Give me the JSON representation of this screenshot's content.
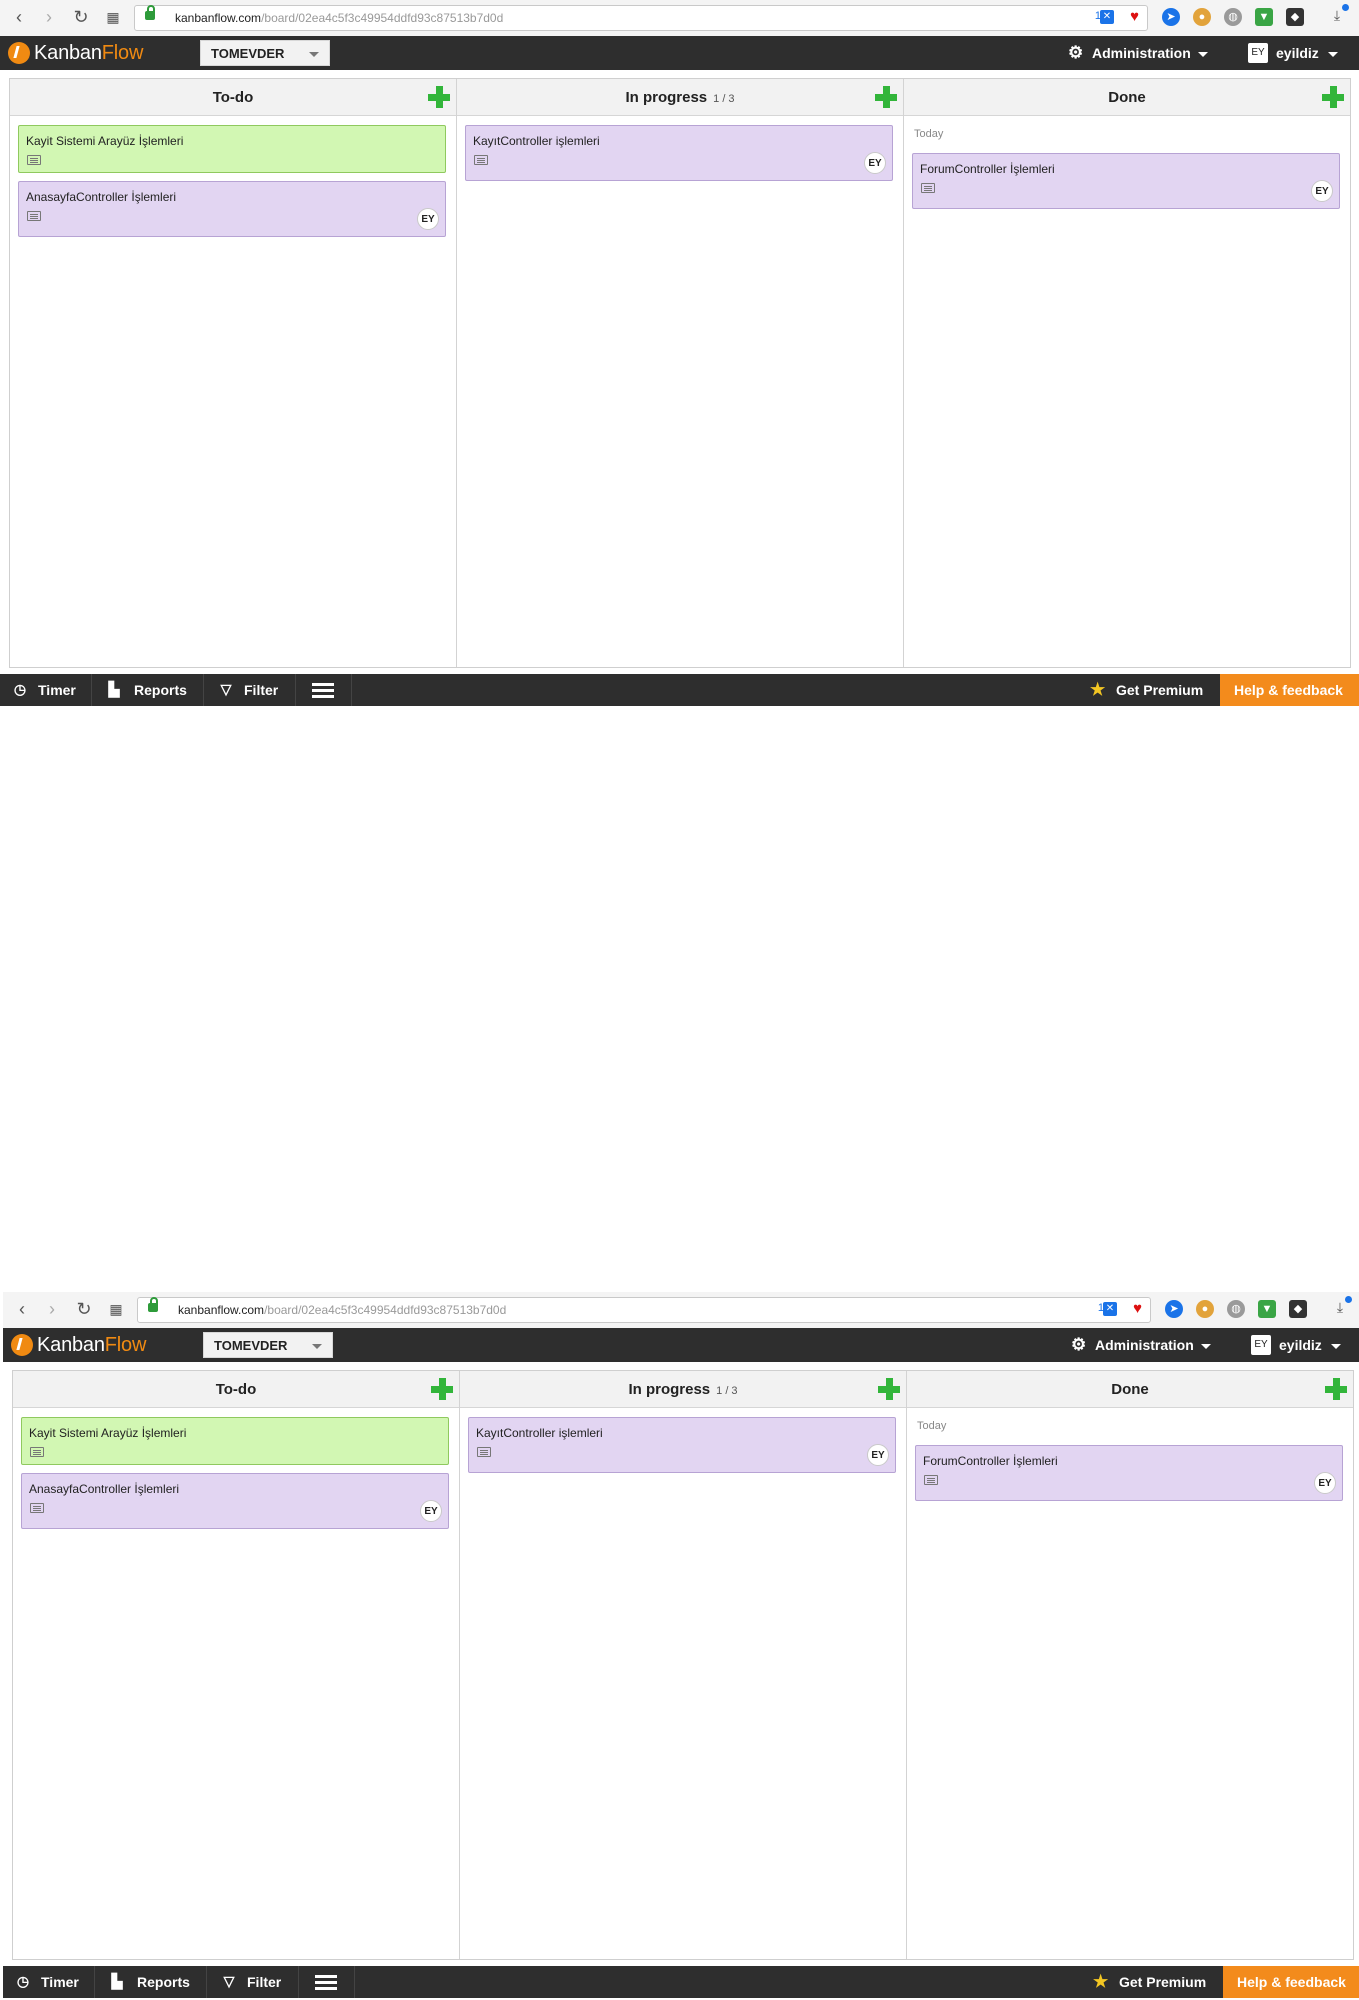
{
  "browser": {
    "url_host": "kanbanflow.com",
    "url_path": "/board/02ea4c5f3c49954ddfd93c87513b7d0d",
    "ext_badge": "1"
  },
  "app": {
    "logo_kanban": "Kanban",
    "logo_flow": "Flow",
    "board_name": "TOMEVDER",
    "admin_label": "Administration",
    "user_initials": "EY",
    "user_name": "eyildiz"
  },
  "columns": [
    {
      "title": "To-do",
      "wip": "",
      "section": "",
      "tasks": [
        {
          "name": "Kayit Sistemi Arayüz İşlemleri",
          "color": "#d2f7b3",
          "assignee": ""
        },
        {
          "name": "AnasayfaController İşlemleri",
          "color": "#e2d5f2",
          "assignee": "EY"
        }
      ]
    },
    {
      "title": "In progress",
      "wip": "1 / 3",
      "section": "",
      "tasks": [
        {
          "name": "KayıtController işlemleri",
          "color": "#e2d5f2",
          "assignee": "EY"
        }
      ]
    },
    {
      "title": "Done",
      "wip": "",
      "section": "Today",
      "tasks": [
        {
          "name": "ForumController İşlemleri",
          "color": "#e2d5f2",
          "assignee": "EY"
        }
      ]
    }
  ],
  "footer": {
    "timer": "Timer",
    "reports": "Reports",
    "filter": "Filter",
    "premium": "Get Premium",
    "help": "Help & feedback"
  },
  "icons": [
    "back-icon",
    "forward-icon",
    "reload-icon",
    "apps-icon",
    "lock-icon",
    "gear-icon",
    "plus-icon",
    "description-icon",
    "clock-icon",
    "report-icon",
    "filter-icon",
    "menu-icon",
    "star-icon"
  ]
}
